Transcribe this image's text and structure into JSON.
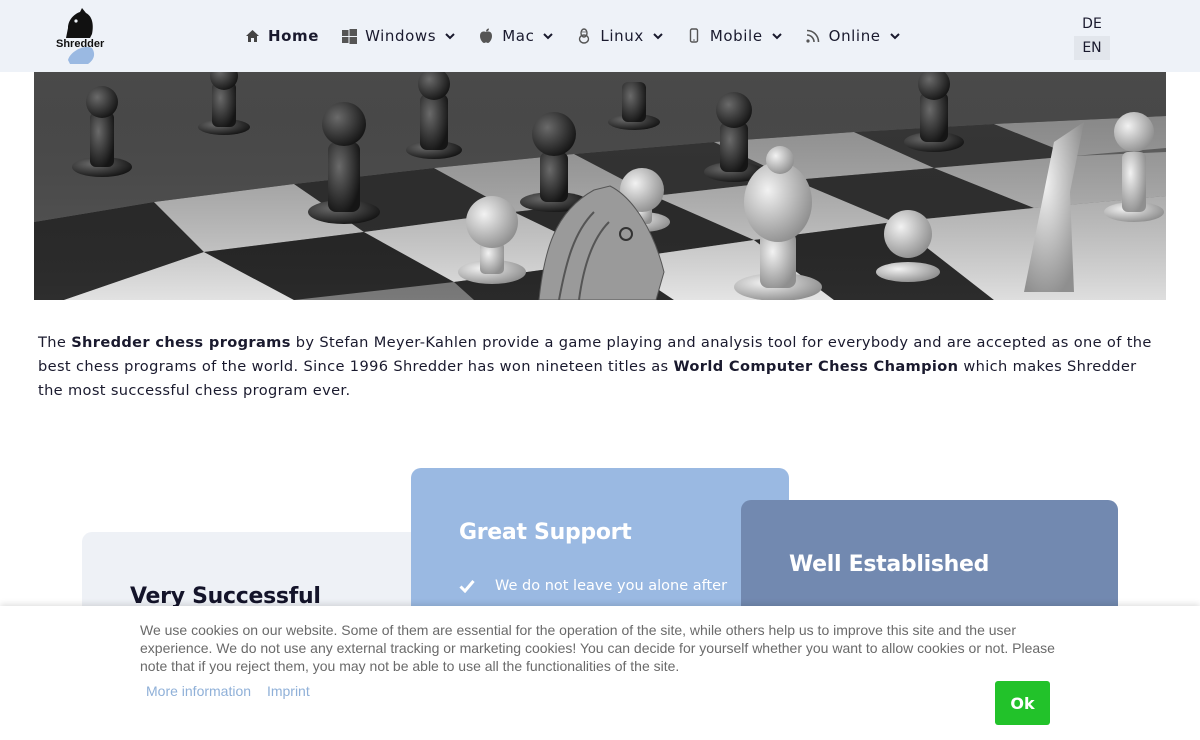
{
  "brand": {
    "logo_text": "Shredder"
  },
  "nav": {
    "items": [
      {
        "label": "Home",
        "icon": "home-icon",
        "has_dropdown": false
      },
      {
        "label": "Windows",
        "icon": "windows-icon",
        "has_dropdown": true
      },
      {
        "label": "Mac",
        "icon": "apple-icon",
        "has_dropdown": true
      },
      {
        "label": "Linux",
        "icon": "linux-icon",
        "has_dropdown": true
      },
      {
        "label": "Mobile",
        "icon": "mobile-icon",
        "has_dropdown": true
      },
      {
        "label": "Online",
        "icon": "rss-icon",
        "has_dropdown": true
      }
    ]
  },
  "languages": {
    "de": "DE",
    "en": "EN",
    "active": "EN"
  },
  "intro": {
    "p1": "The ",
    "b1": "Shredder chess programs",
    "p2": " by Stefan Meyer-Kahlen provide a game playing and analysis tool for everybody and are accepted as one of the best chess programs of the world. Since 1996 Shredder has won nineteen titles as ",
    "b2": "World Computer Chess Champion",
    "p3": " which makes Shredder the most successful chess program ever."
  },
  "cards": {
    "c1": {
      "title": "Very Successful"
    },
    "c2": {
      "title": "Great Support",
      "point": "We do not leave you alone after"
    },
    "c3": {
      "title": "Well Established"
    }
  },
  "cookie": {
    "text": "We use cookies on our website. Some of them are essential for the operation of the site, while others help us to improve this site and the user experience. We do not use any external tracking or marketing cookies! You can decide for yourself whether you want to allow cookies or not. Please note that if you reject them, you may not be able to use all the functionalities of the site.",
    "more_info": "More information",
    "imprint": "Imprint",
    "ok": "Ok"
  },
  "colors": {
    "header_bg": "#eef2f8",
    "card1_bg": "#eef1f6",
    "card2_bg": "#9ab9e2",
    "card3_bg": "#7289b0",
    "ok_button": "#22c22a",
    "link": "#8fb0d8"
  }
}
